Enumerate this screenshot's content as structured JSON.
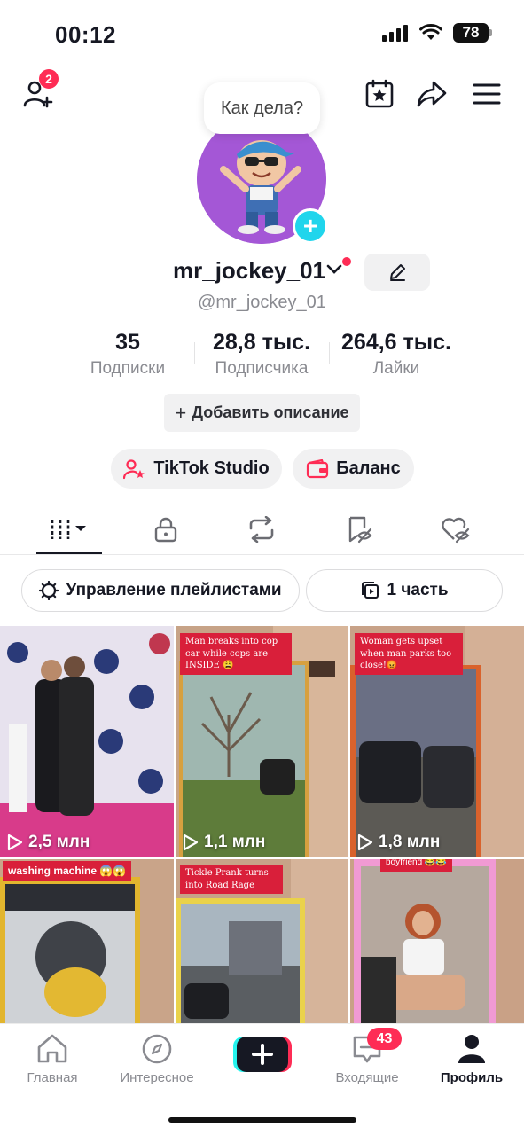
{
  "status_bar": {
    "time": "00:12",
    "battery": "78"
  },
  "header": {
    "friends_badge": "2"
  },
  "bubble": {
    "text": "Как дела?"
  },
  "profile": {
    "username": "mr_jockey_01",
    "handle": "@mr_jockey_01"
  },
  "stats": [
    {
      "value": "35",
      "label": "Подписки"
    },
    {
      "value": "28,8 тыс.",
      "label": "Подписчика"
    },
    {
      "value": "264,6 тыс.",
      "label": "Лайки"
    }
  ],
  "add_description": {
    "label": "Добавить описание",
    "plus": "+"
  },
  "pills": {
    "studio": "TikTok Studio",
    "balance": "Баланс"
  },
  "playlist": {
    "manage": "Управление плейлистами",
    "parts": "1 часть"
  },
  "videos": [
    {
      "views": "2,5 млн",
      "caption": ""
    },
    {
      "views": "1,1 млн",
      "caption": "Man breaks into cop car while cops are INSIDE 😩"
    },
    {
      "views": "1,8 млн",
      "caption": "Woman gets upset when man parks too close!😡"
    },
    {
      "views": "",
      "caption": "washing machine 😱😱"
    },
    {
      "views": "",
      "caption": "Tickle Prank turns into Road Rage"
    },
    {
      "views": "",
      "caption": "boyfriend 😂😂"
    }
  ],
  "nav": {
    "home": "Главная",
    "discover": "Интересное",
    "inbox": "Входящие",
    "inbox_badge": "43",
    "profile": "Профиль"
  },
  "colors": {
    "accent": "#fe2c55",
    "cyan": "#20d5ec",
    "avatar_bg": "#a457d6"
  }
}
